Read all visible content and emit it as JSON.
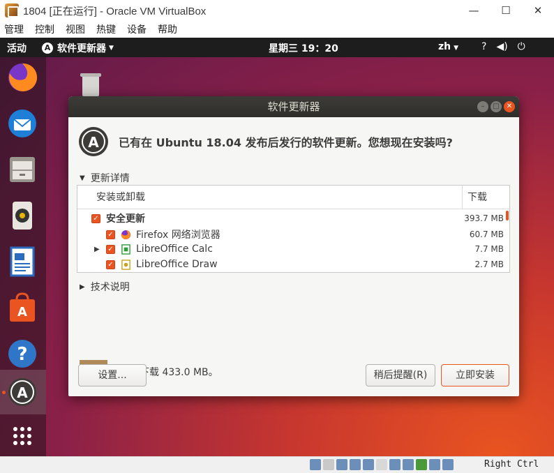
{
  "vbox": {
    "title": "1804 [正在运行] - Oracle VM VirtualBox",
    "menu": [
      "管理",
      "控制",
      "视图",
      "热键",
      "设备",
      "帮助"
    ],
    "controls": {
      "minimize": "—",
      "maximize": "☐",
      "close": "✕"
    },
    "statusbar": {
      "host_key": "Right Ctrl"
    }
  },
  "topbar": {
    "activities": "活动",
    "app_menu": "软件更新器",
    "clock": "星期三 19：20",
    "lang": "zh"
  },
  "dock": {
    "items": [
      "firefox-icon",
      "thunderbird-icon",
      "files-icon",
      "rhythmbox-icon",
      "libreoffice-writer-icon",
      "software-icon",
      "help-icon",
      "software-updater-icon",
      "show-apps-icon"
    ]
  },
  "dialog": {
    "title": "软件更新器",
    "header": "已有在 Ubuntu 18.04 发布后发行的软件更新。您想现在安装吗?",
    "details_label": "更新详情",
    "table": {
      "col_name": "安装或卸载",
      "col_size": "下载",
      "rows": [
        {
          "name": "安全更新",
          "size": "393.7 MB",
          "level": 0,
          "bold": true
        },
        {
          "name": "Firefox 网络浏览器",
          "size": "60.7 MB",
          "level": 1
        },
        {
          "name": "LibreOffice Calc",
          "size": "7.7 MB",
          "level": 1
        },
        {
          "name": "LibreOffice Draw",
          "size": "2.7 MB",
          "level": 1
        }
      ]
    },
    "tech_label": "技术说明",
    "download_text": "将会下载 433.0 MB。",
    "buttons": {
      "settings": "设置...",
      "later": "稍后提醒(R)",
      "install": "立即安装"
    }
  },
  "colors": {
    "accent": "#e95420",
    "topbar": "#1d1d1d",
    "dialog_title": "#3c3b37"
  }
}
